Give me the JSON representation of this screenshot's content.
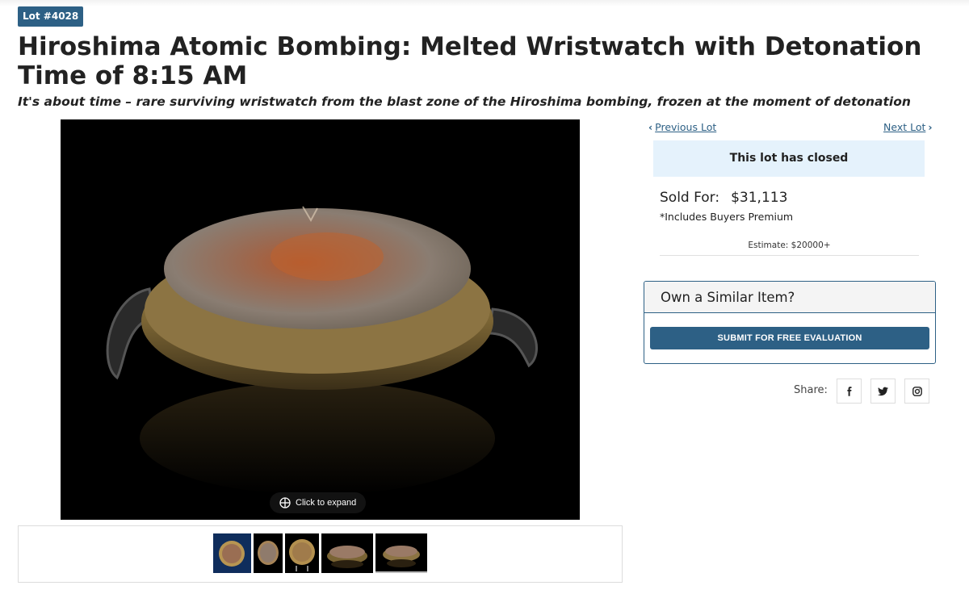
{
  "lot": {
    "badge": "Lot #4028"
  },
  "title": "Hiroshima Atomic Bombing: Melted Wristwatch with Detonation Time of 8:15 AM",
  "subtitle": "It's about time – rare surviving wristwatch from the blast zone of the Hiroshima bombing, frozen at the moment of detonation",
  "image": {
    "expand_label": "Click to expand"
  },
  "thumbnails": 5,
  "nav": {
    "previous": "Previous Lot",
    "next": "Next Lot"
  },
  "status": {
    "closed_text": "This lot has closed"
  },
  "sale": {
    "sold_label": "Sold For:",
    "sold_amount": "$31,113",
    "premium_note": "*Includes Buyers Premium",
    "estimate": "Estimate: $20000+"
  },
  "similar": {
    "heading": "Own a Similar Item?",
    "button": "SUBMIT FOR FREE EVALUATION"
  },
  "share": {
    "label": "Share:",
    "icons": [
      "facebook-icon",
      "twitter-icon",
      "instagram-icon"
    ]
  },
  "colors": {
    "brand": "#2d6085",
    "closed_bg": "#e5f2fc",
    "link": "#2d6085"
  }
}
